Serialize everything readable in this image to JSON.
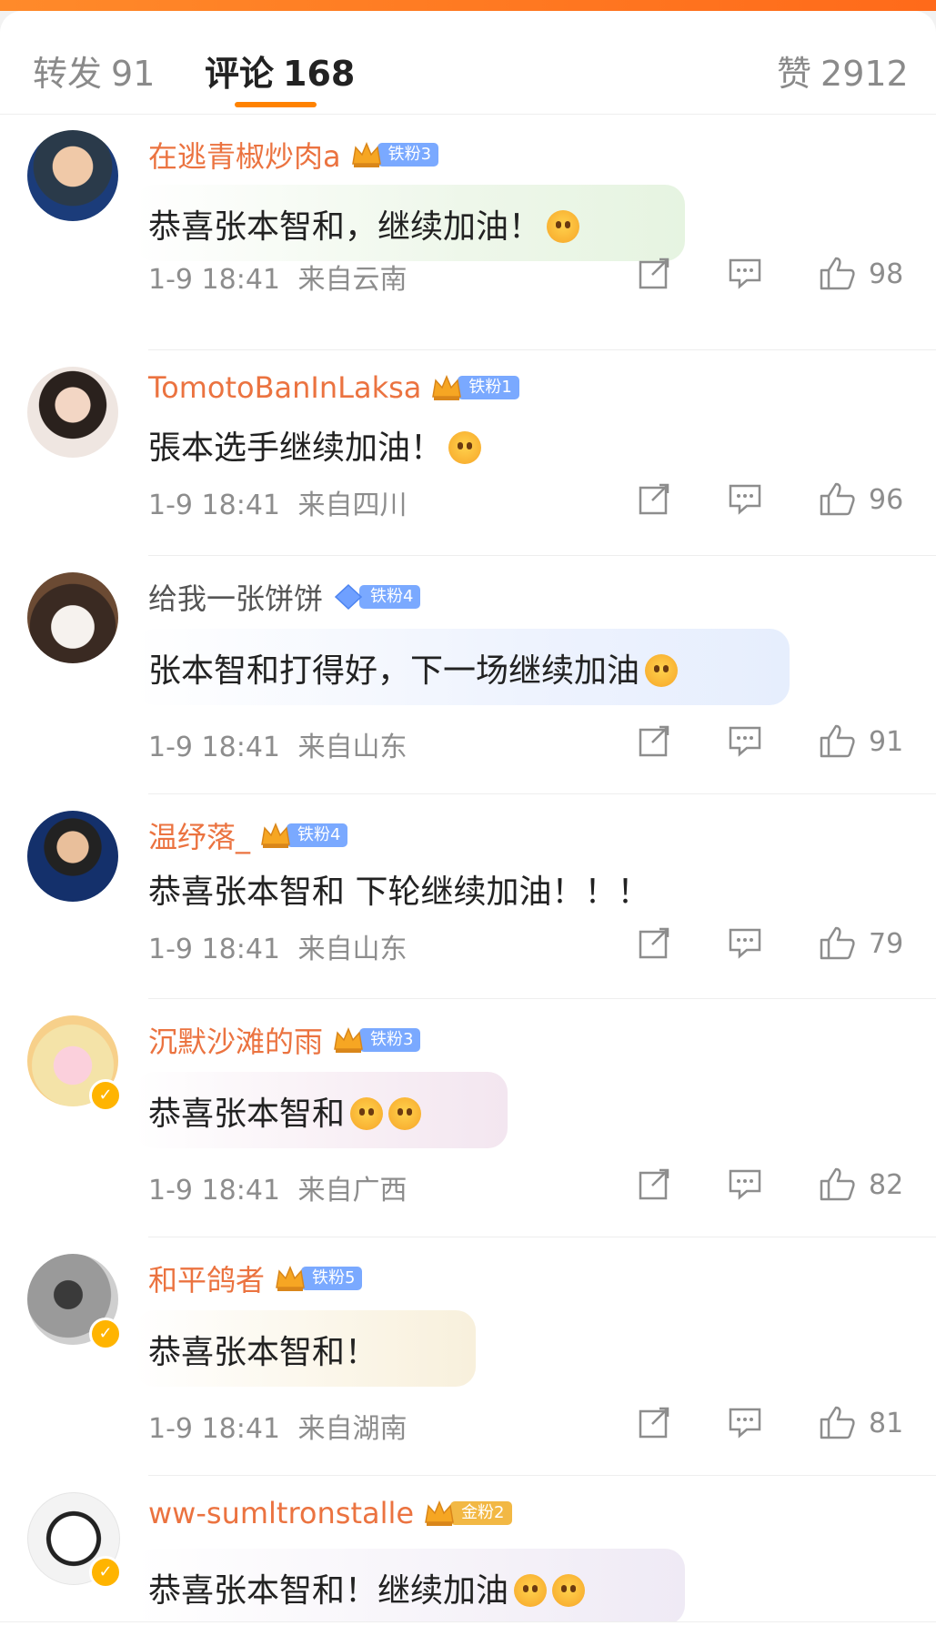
{
  "tabs": {
    "repost_label": "转发",
    "repost_count": "91",
    "comment_label": "评论",
    "comment_count": "168",
    "like_label": "赞",
    "like_count": "2912"
  },
  "colors": {
    "accent": "#ff8200",
    "username": "#eb7340",
    "meta": "#8d8d8d",
    "badge_blue": "#7aa9ff",
    "badge_gold": "#f2b844"
  },
  "comments": [
    {
      "username": "在逃青椒炒肉a",
      "badge": "铁粉3",
      "text": "恭喜张本智和，继续加油！",
      "time": "1-9 18:41",
      "location": "来自云南",
      "likes": "98"
    },
    {
      "username": "TomotoBanInLaksa",
      "badge": "铁粉1",
      "text": "張本选手继续加油！",
      "time": "1-9 18:41",
      "location": "来自四川",
      "likes": "96"
    },
    {
      "username": "给我一张饼饼",
      "badge": "铁粉4",
      "text": "张本智和打得好，下一场继续加油",
      "time": "1-9 18:41",
      "location": "来自山东",
      "likes": "91"
    },
    {
      "username": "温纾落_",
      "badge": "铁粉4",
      "text": "恭喜张本智和  下轮继续加油！！！",
      "time": "1-9 18:41",
      "location": "来自山东",
      "likes": "79"
    },
    {
      "username": "沉默沙滩的雨",
      "badge": "铁粉3",
      "text": "恭喜张本智和",
      "time": "1-9 18:41",
      "location": "来自广西",
      "likes": "82"
    },
    {
      "username": "和平鸽者",
      "badge": "铁粉5",
      "text": "恭喜张本智和！",
      "time": "1-9 18:41",
      "location": "来自湖南",
      "likes": "81"
    },
    {
      "username": "ww-sumltronstalle",
      "badge": "金粉2",
      "text": "恭喜张本智和！继续加油",
      "time": "",
      "location": "",
      "likes": ""
    }
  ],
  "icons": [
    "share-icon",
    "comment-icon",
    "like-icon",
    "verified-icon",
    "crown-icon",
    "emoji-icon"
  ]
}
